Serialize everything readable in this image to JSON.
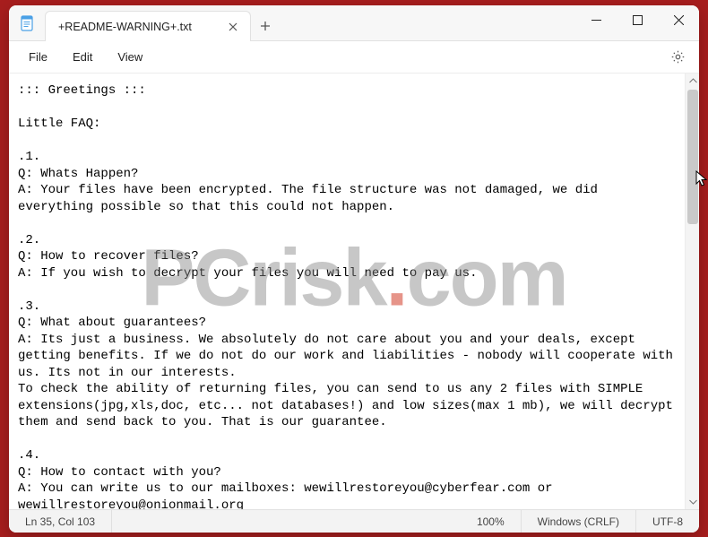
{
  "tab": {
    "title": "+README-WARNING+.txt"
  },
  "menu": {
    "file": "File",
    "edit": "Edit",
    "view": "View"
  },
  "document": {
    "text": "::: Greetings :::\n\nLittle FAQ:\n\n.1.\nQ: Whats Happen?\nA: Your files have been encrypted. The file structure was not damaged, we did everything possible so that this could not happen.\n\n.2.\nQ: How to recover files?\nA: If you wish to decrypt your files you will need to pay us.\n\n.3.\nQ: What about guarantees?\nA: Its just a business. We absolutely do not care about you and your deals, except getting benefits. If we do not do our work and liabilities - nobody will cooperate with us. Its not in our interests.\nTo check the ability of returning files, you can send to us any 2 files with SIMPLE extensions(jpg,xls,doc, etc... not databases!) and low sizes(max 1 mb), we will decrypt them and send back to you. That is our guarantee.\n\n.4.\nQ: How to contact with you?\nA: You can write us to our mailboxes: wewillrestoreyou@cyberfear.com or wewillrestoreyou@onionmail.org"
  },
  "status": {
    "position": "Ln 35, Col 103",
    "zoom": "100%",
    "line_ending": "Windows (CRLF)",
    "encoding": "UTF-8"
  },
  "watermark": {
    "left": "PCrisk",
    "right": "com"
  }
}
